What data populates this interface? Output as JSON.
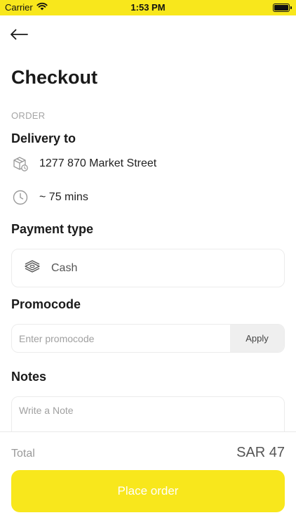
{
  "status_bar": {
    "carrier": "Carrier",
    "time": "1:53 PM",
    "icons": [
      "wifi-icon",
      "battery-icon"
    ],
    "background": "#f8e71c"
  },
  "header": {
    "back_icon": "arrow-left-icon",
    "title": "Checkout"
  },
  "order": {
    "section_label": "ORDER",
    "delivery_heading": "Delivery to",
    "address": "1277 870 Market Street",
    "address_icon": "delivery-box-icon",
    "eta": "~ 75 mins",
    "eta_icon": "clock-icon"
  },
  "payment": {
    "heading": "Payment type",
    "method": "Cash",
    "method_icon": "cash-icon"
  },
  "promo": {
    "heading": "Promocode",
    "placeholder": "Enter promocode",
    "value": "",
    "apply_label": "Apply"
  },
  "notes": {
    "heading": "Notes",
    "placeholder": "Write a Note",
    "value": ""
  },
  "summary": {
    "total_label": "Total",
    "total_value": "SAR 47"
  },
  "actions": {
    "place_order_label": "Place order",
    "accent": "#f8e71c"
  }
}
